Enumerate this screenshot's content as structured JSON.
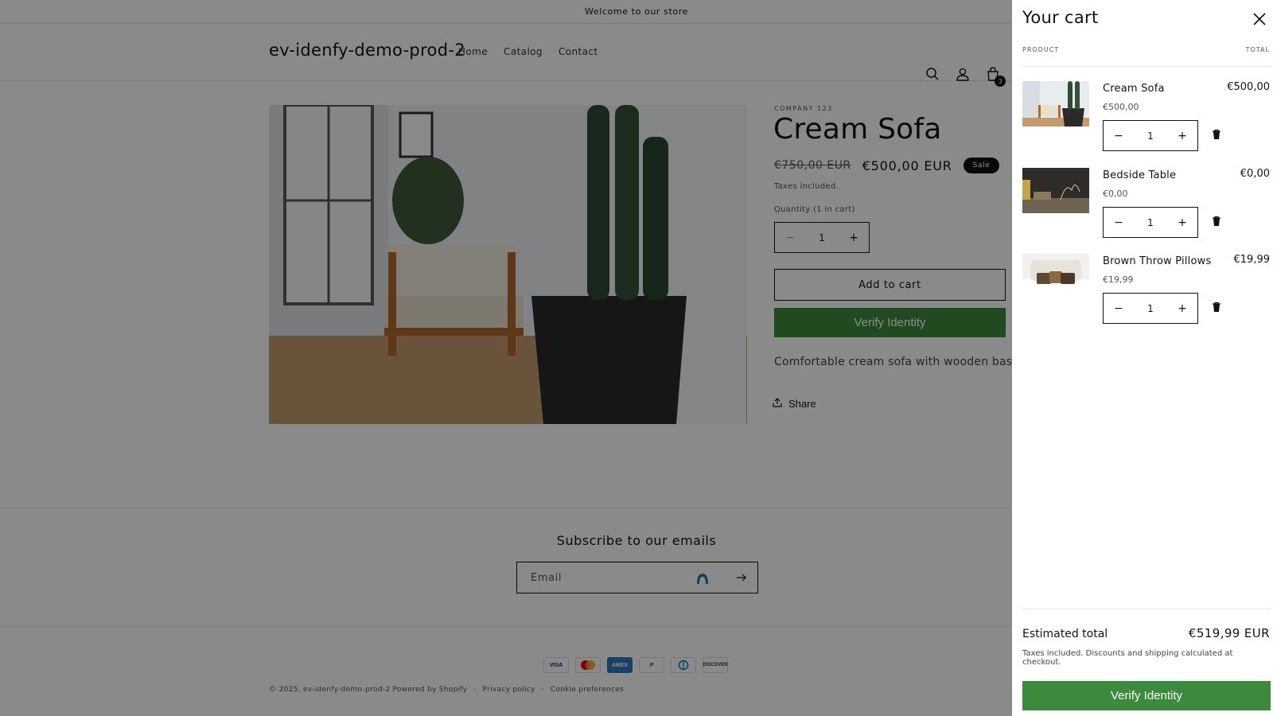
{
  "announcement": "Welcome to our store",
  "header": {
    "logo": "ev-idenfy-demo-prod-2",
    "nav": [
      "Home",
      "Catalog",
      "Contact"
    ],
    "cart_count": "3"
  },
  "product": {
    "vendor": "COMPANY 123",
    "title": "Cream Sofa",
    "price_old": "€750,00 EUR",
    "price_new": "€500,00 EUR",
    "badge": "Sale",
    "taxes": "Taxes included.",
    "quantity_label": "Quantity (1 in cart)",
    "quantity": "1",
    "add_to_cart": "Add to cart",
    "verify": "Verify Identity",
    "description": "Comfortable cream sofa with wooden base",
    "share": "Share"
  },
  "subscribe": {
    "title": "Subscribe to our emails",
    "email_placeholder": "Email"
  },
  "footer": {
    "payments": [
      "VISA",
      "Mastercard",
      "AMEX",
      "PayPal",
      "Diners",
      "DISCOVER"
    ],
    "copyright": "© 2025, ev-idenfy-demo-prod-2 Powered by Shopify",
    "privacy": "Privacy policy",
    "cookie": "Cookie preferences",
    "sep": "·"
  },
  "cart": {
    "title": "Your cart",
    "col_product": "PRODUCT",
    "col_total": "TOTAL",
    "items": [
      {
        "name": "Cream Sofa",
        "price": "€500,00",
        "quantity": "1",
        "total": "€500,00"
      },
      {
        "name": "Bedside Table",
        "price": "€0,00",
        "quantity": "1",
        "total": "€0,00"
      },
      {
        "name": "Brown Throw Pillows",
        "price": "€19,99",
        "quantity": "1",
        "total": "€19,99"
      }
    ],
    "estimated_label": "Estimated total",
    "estimated_value": "€519,99 EUR",
    "note": "Taxes included. Discounts and shipping calculated at checkout.",
    "verify": "Verify Identity"
  },
  "colors": {
    "verify_green": "#3c8b3c",
    "overlay": "rgba(0,0,0,0.46)",
    "text": "#121212"
  }
}
